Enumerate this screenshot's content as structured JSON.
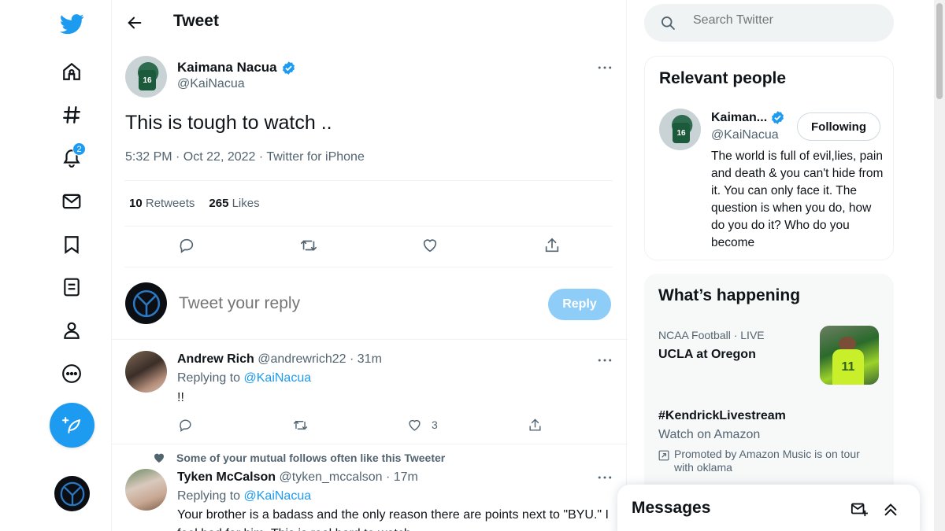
{
  "nav": {
    "notification_count": "2"
  },
  "header": {
    "title": "Tweet"
  },
  "tweet": {
    "author_name": "Kaimana Nacua",
    "author_handle": "@KaiNacua",
    "jersey_number": "16",
    "text": "This is tough to watch ..",
    "meta": "5:32 PM · Oct 22, 2022 · Twitter for iPhone",
    "retweets_count": "10",
    "retweets_label": "Retweets",
    "likes_count": "265",
    "likes_label": "Likes"
  },
  "reply_box": {
    "placeholder": "Tweet your reply",
    "button_label": "Reply"
  },
  "replies": [
    {
      "name": "Andrew Rich",
      "handle_time": "@andrewrich22 · 31m",
      "replying_prefix": "Replying to",
      "replying_to": "@KaiNacua",
      "text": "!!",
      "like_count": "3"
    },
    {
      "social_context": "Some of your mutual follows often like this Tweeter",
      "name": "Tyken McCalson",
      "handle_time": "@tyken_mccalson · 17m",
      "replying_prefix": "Replying to",
      "replying_to": "@KaiNacua",
      "text": "Your brother is a badass and the only reason there are points next to \"BYU.\" I feel bad for him. This is real hard to watch."
    }
  ],
  "search": {
    "placeholder": "Search Twitter"
  },
  "relevant_people": {
    "title": "Relevant people",
    "name": "Kaiman...",
    "handle": "@KaiNacua",
    "follow_label": "Following",
    "bio": "The world is full of evil,lies, pain and death & you can't hide from it. You can only face it. The question is when you do, how do you do it? Who do you become"
  },
  "whats_happening": {
    "title": "What’s happening",
    "trends": [
      {
        "category": "NCAA Football · LIVE",
        "title": "UCLA at Oregon",
        "image_number": "11"
      },
      {
        "title": "#KendrickLivestream",
        "subtitle": "Watch on Amazon",
        "promo": "Promoted by Amazon Music is on tour with oklama"
      }
    ]
  },
  "messages": {
    "title": "Messages"
  },
  "colors": {
    "accent": "#1d9bf0",
    "reply_button_disabled": "#8ecdf8",
    "secondary_text": "#536471"
  },
  "icons": [
    "twitter-logo-icon",
    "home-icon",
    "explore-hash-icon",
    "bell-icon",
    "mail-icon",
    "bookmark-icon",
    "lists-icon",
    "profile-icon",
    "more-circle-icon",
    "compose-icon",
    "back-arrow-icon",
    "verified-icon",
    "more-dots-icon",
    "reply-icon",
    "retweet-icon",
    "like-icon",
    "share-icon",
    "search-icon",
    "new-message-icon",
    "chevron-double-up-icon"
  ]
}
